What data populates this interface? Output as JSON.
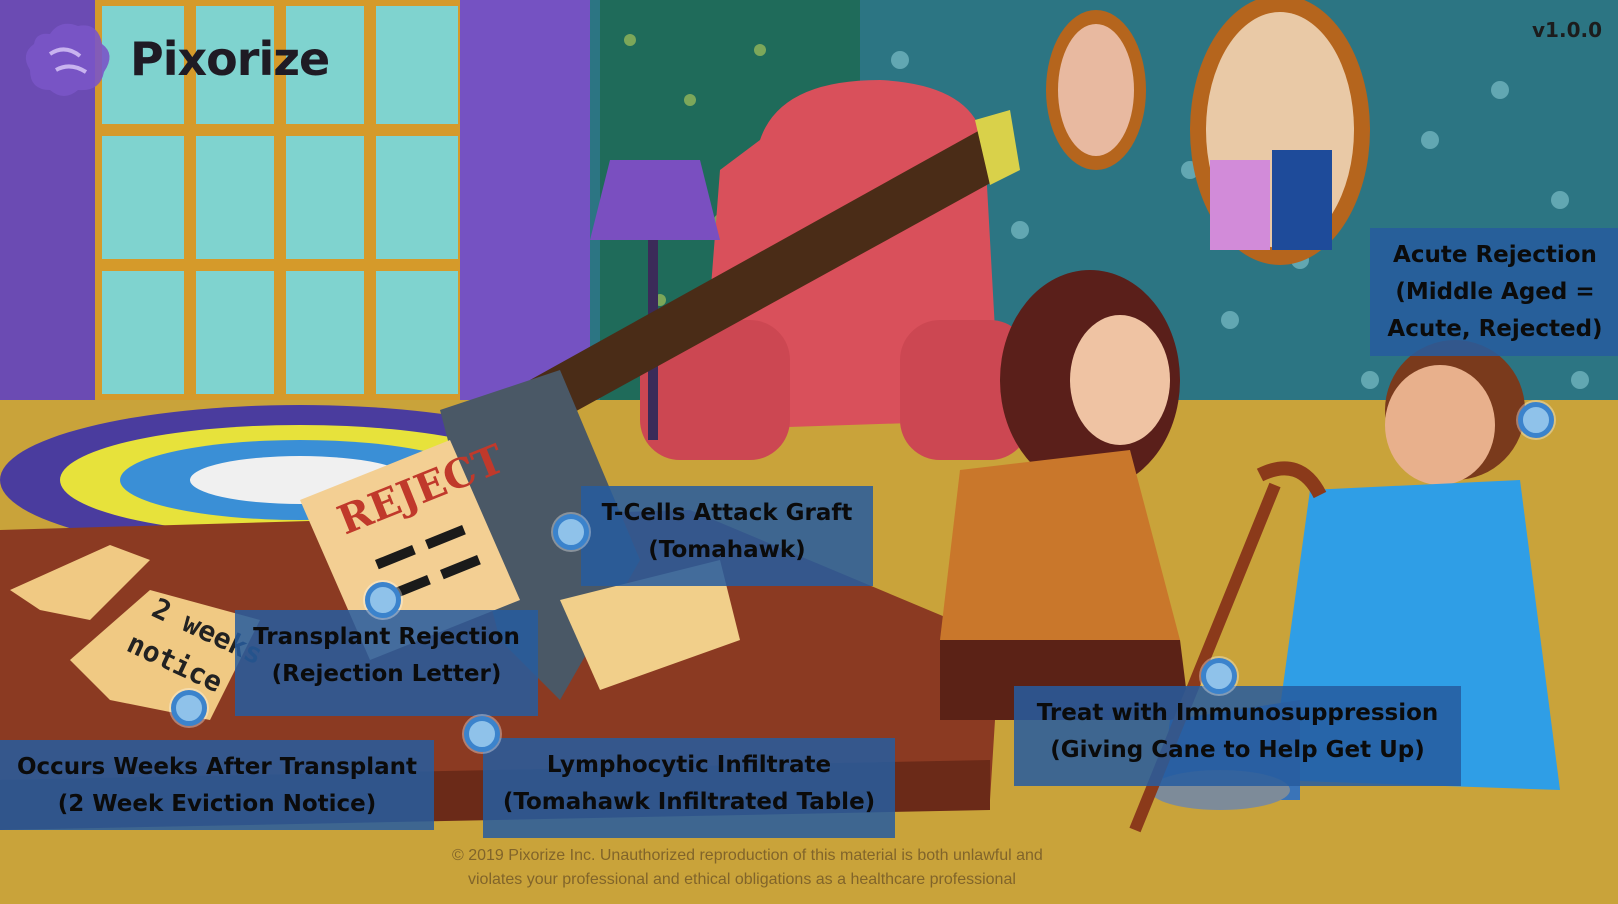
{
  "app": {
    "logo_text": "Pixorize",
    "version": "v1.0.0"
  },
  "hotspots": [
    {
      "id": "acute-rejection",
      "title": "Acute Rejection",
      "lines": [
        "(Middle Aged =",
        "Acute, Rejected)"
      ]
    },
    {
      "id": "t-cells-attack-graft",
      "title": "T-Cells Attack Graft",
      "lines": [
        "(Tomahawk)"
      ]
    },
    {
      "id": "transplant-rejection",
      "title": "Transplant Rejection",
      "lines": [
        "(Rejection Letter)"
      ]
    },
    {
      "id": "treat-with-immunosuppression",
      "title": "Treat with Immunosuppression",
      "lines": [
        "(Giving Cane to Help Get Up)"
      ]
    },
    {
      "id": "occurs-weeks-after-transplant",
      "title": "Occurs Weeks After Transplant",
      "lines": [
        "(2 Week Eviction Notice)"
      ]
    },
    {
      "id": "lymphocytic-infiltrate",
      "title": "Lymphocytic Infiltrate",
      "lines": [
        "(Tomahawk Infiltrated Table)"
      ]
    }
  ],
  "scene_text": {
    "letter_word": "REJECT",
    "notice_line1": "2 weeks",
    "notice_line2": "notice"
  },
  "footer": {
    "copyright_line1": "© 2019 Pixorize Inc. Unauthorized reproduction of this material is both unlawful and",
    "copyright_line2": "violates your professional and ethical obligations as a healthcare professional"
  },
  "colors": {
    "label_bg": "#265c9e",
    "hotspot_fill": "#8fc2ea",
    "hotspot_ring": "#3b83cc",
    "wall": "#2f7a86",
    "floor": "#c9a33a"
  }
}
